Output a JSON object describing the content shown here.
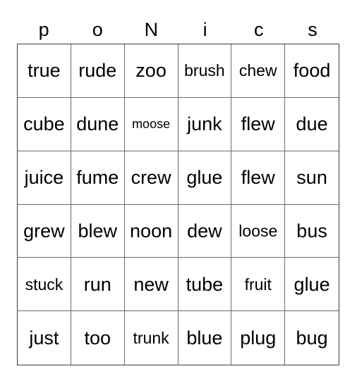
{
  "card": {
    "type": "bingo-card",
    "columns": 6,
    "rows": 6,
    "header": {
      "letters": [
        "p",
        "o",
        "N",
        "i",
        "c",
        "s"
      ]
    },
    "grid": [
      [
        {
          "text": "true",
          "size": "lg"
        },
        {
          "text": "rude",
          "size": "lg"
        },
        {
          "text": "zoo",
          "size": "lg"
        },
        {
          "text": "brush",
          "size": "md"
        },
        {
          "text": "chew",
          "size": "md"
        },
        {
          "text": "food",
          "size": "lg"
        }
      ],
      [
        {
          "text": "cube",
          "size": "lg"
        },
        {
          "text": "dune",
          "size": "lg"
        },
        {
          "text": "moose",
          "size": "sm"
        },
        {
          "text": "junk",
          "size": "lg"
        },
        {
          "text": "flew",
          "size": "lg"
        },
        {
          "text": "due",
          "size": "lg"
        }
      ],
      [
        {
          "text": "juice",
          "size": "lg"
        },
        {
          "text": "fume",
          "size": "lg"
        },
        {
          "text": "crew",
          "size": "lg"
        },
        {
          "text": "glue",
          "size": "lg"
        },
        {
          "text": "flew",
          "size": "lg"
        },
        {
          "text": "sun",
          "size": "lg"
        }
      ],
      [
        {
          "text": "grew",
          "size": "lg"
        },
        {
          "text": "blew",
          "size": "lg"
        },
        {
          "text": "noon",
          "size": "lg"
        },
        {
          "text": "dew",
          "size": "lg"
        },
        {
          "text": "loose",
          "size": "md"
        },
        {
          "text": "bus",
          "size": "lg"
        }
      ],
      [
        {
          "text": "stuck",
          "size": "md"
        },
        {
          "text": "run",
          "size": "lg"
        },
        {
          "text": "new",
          "size": "lg"
        },
        {
          "text": "tube",
          "size": "lg"
        },
        {
          "text": "fruit",
          "size": "md"
        },
        {
          "text": "glue",
          "size": "lg"
        }
      ],
      [
        {
          "text": "just",
          "size": "lg"
        },
        {
          "text": "too",
          "size": "lg"
        },
        {
          "text": "trunk",
          "size": "md"
        },
        {
          "text": "blue",
          "size": "lg"
        },
        {
          "text": "plug",
          "size": "lg"
        },
        {
          "text": "bug",
          "size": "lg"
        }
      ]
    ],
    "colors": {
      "background": "#ffffff",
      "text": "#000000",
      "grid_line": "#6b6b6b",
      "outer_border": "#3a3a3a"
    }
  }
}
